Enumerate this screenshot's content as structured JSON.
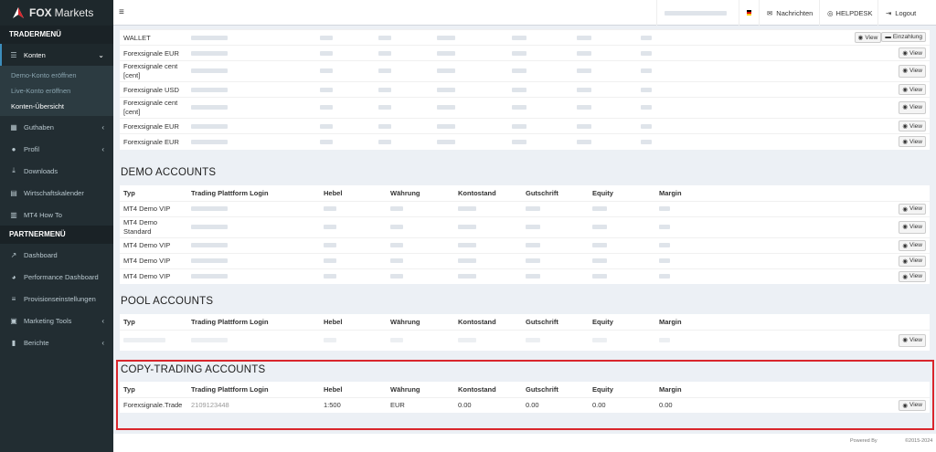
{
  "brand": {
    "name_bold": "FOX",
    "name_rest": "Markets"
  },
  "sidebar": {
    "trader_header": "TRADERMENÜ",
    "konten": "Konten",
    "sub": [
      "Demo-Konto eröffnen",
      "Live-Konto eröffnen",
      "Konten-Übersicht"
    ],
    "items": [
      "Guthaben",
      "Profil",
      "Downloads",
      "Wirtschaftskalender",
      "MT4 How To"
    ],
    "partner_header": "PARTNERMENÜ",
    "partner_items": [
      "Dashboard",
      "Performance Dashboard",
      "Provisionseinstellungen",
      "Marketing Tools",
      "Berichte"
    ]
  },
  "topbar": {
    "nachrichten": "Nachrichten",
    "helpdesk": "HELPDESK",
    "logout": "Logout"
  },
  "live": {
    "rows": [
      {
        "typ": "WALLET",
        "tall": false,
        "einzahlung": true
      },
      {
        "typ": "Forexsignale EUR",
        "tall": false
      },
      {
        "typ": "Forexsignale cent [cent]",
        "tall": true
      },
      {
        "typ": "Forexsignale USD",
        "tall": false
      },
      {
        "typ": "Forexsignale cent [cent]",
        "tall": true
      },
      {
        "typ": "Forexsignale EUR",
        "tall": false
      },
      {
        "typ": "Forexsignale EUR",
        "tall": false
      }
    ]
  },
  "labels": {
    "view": "View",
    "einzahlung": "Einzahlung"
  },
  "columns": [
    "Typ",
    "Trading Plattform Login",
    "Hebel",
    "Währung",
    "Kontostand",
    "Gutschrift",
    "Equity",
    "Margin"
  ],
  "demo": {
    "title": "DEMO ACCOUNTS",
    "rows": [
      {
        "typ": "MT4 Demo VIP",
        "tall": false
      },
      {
        "typ": "MT4 Demo Standard",
        "tall": true
      },
      {
        "typ": "MT4 Demo VIP",
        "tall": false
      },
      {
        "typ": "MT4 Demo VIP",
        "tall": false
      },
      {
        "typ": "MT4 Demo VIP",
        "tall": false
      }
    ]
  },
  "pool": {
    "title": "POOL ACCOUNTS"
  },
  "copy": {
    "title": "COPY-TRADING ACCOUNTS",
    "row": {
      "typ": "Forexsignale.Trade",
      "login": "2109123448",
      "hebel": "1:500",
      "waehrung": "EUR",
      "kontostand": "0.00",
      "gutschrift": "0.00",
      "equity": "0.00",
      "margin": "0.00"
    }
  },
  "footer": {
    "powered": "Powered By",
    "copyright": "©2015-2024"
  }
}
